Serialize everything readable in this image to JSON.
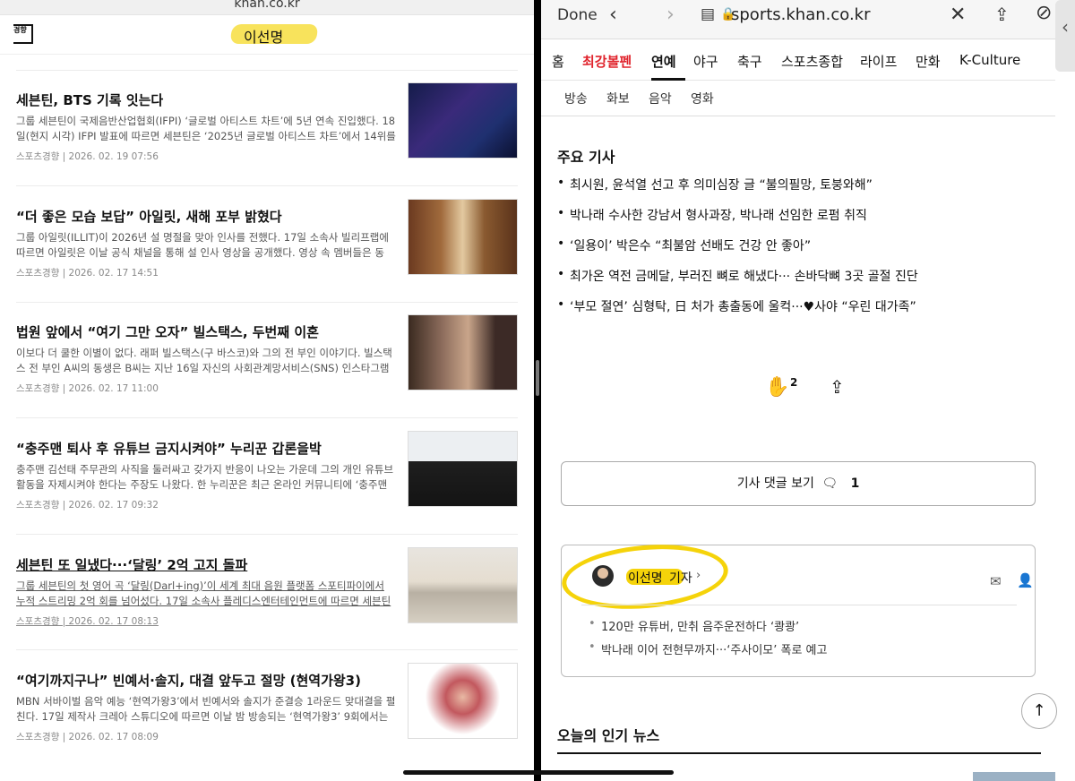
{
  "left": {
    "url": "khan.co.kr",
    "logo": "경향",
    "title": "이선명",
    "articles": [
      {
        "title": "세븐틴, BTS 기록 잇는다",
        "summary": "그룹 세븐틴이 국제음반산업협회(IFPI) ‘글로벌 아티스트 차트’에 5년 연속 진입했다. 18일(현지 시각) IFPI 발표에 따르면 세븐틴은 ‘2025년 글로벌 아티스트 차트’에서 14위를 기록…",
        "meta": "스포츠경향 | 2026. 02. 19 07:56"
      },
      {
        "title": "“더 좋은 모습 보답” 아일릿, 새해 포부 밝혔다",
        "summary": "그룹 아일릿(ILLIT)이 2026년 설 명절을 맞아 인사를 전했다. 17일 소속사 빌리프랩에 따르면 아일릿은 이날 공식 채널을 통해 설 인사 영상을 공개했다. 영상 속 멤버들은 동양…",
        "meta": "스포츠경향 | 2026. 02. 17 14:51"
      },
      {
        "title": "법원 앞에서 “여기 그만 오자” 빌스택스, 두번째 이혼",
        "summary": "이보다 더 쿨한 이별이 없다. 래퍼 빌스택스(구 바스코)와 그의 전 부인 이야기다. 빌스택스 전 부인 A씨의 동생은 B씨는 지난 16일 자신의 사회관계망서비스(SNS) 인스타그램에 “이혼…",
        "meta": "스포츠경향 | 2026. 02. 17 11:00"
      },
      {
        "title": "“충주맨 퇴사 후 유튜브 금지시켜야” 누리꾼 갑론을박",
        "summary": "충주맨 김선태 주무관의 사직을 둘러싸고 갖가지 반응이 나오는 가운데 그의 개인 유튜브 활동을 자제시켜야 한다는 주장도 나왔다. 한 누리꾼은 최근 온라인 커뮤니티에 ‘충주맨 퇴…",
        "meta": "스포츠경향 | 2026. 02. 17 09:32"
      },
      {
        "title": "세븐틴 또 일냈다···‘달링’ 2억 고지 돌파",
        "summary": "그룹 세븐틴의 첫 영어 곡 ‘달링(Darl+ing)’이 세계 최대 음원 플랫폼 스포티파이에서 누적 스트리밍 2억 회를 넘어섰다. 17일 소속사 플레디스엔터테인먼트에 따르면 세븐틴 정규 4집…",
        "meta": "스포츠경향 | 2026. 02. 17 08:13"
      },
      {
        "title": "“여기까지구나” 빈예서·솔지, 대결 앞두고 절망 (현역가왕3)",
        "summary": "MBN 서바이벌 음악 예능 ‘현역가왕3’에서 빈예서와 솔지가 준결승 1라운드 맞대결을 펼친다. 17일 제작사 크레아 스튜디오에 따르면 이날 밤 방송되는 ‘현역가왕3’ 9회에서는 준결…",
        "meta": "스포츠경향 | 2026. 02. 17 08:09"
      }
    ]
  },
  "right": {
    "done": "Done",
    "host": "sports.khan.co.kr",
    "nav": [
      "홈",
      "최강볼펜",
      "연예",
      "야구",
      "축구",
      "스포츠종합",
      "라이프",
      "만화",
      "K-Culture"
    ],
    "subnav": [
      "방송",
      "화보",
      "음악",
      "영화"
    ],
    "key_title": "주요 기사",
    "key_articles": [
      "최시원, 윤석열 선고 후 의미심장 글 “불의필망, 토붕와해”",
      "박나래 수사한 강남서 형사과장, 박나래 선임한 로펌 취직",
      "‘일용이’ 박은수 “최불암 선배도 건강 안 좋아”",
      "최가온 역전 금메달, 부러진 뼈로 해냈다··· 손바닥뼈 3곳 골절 진단",
      "‘부모 절연’ 심형탁, 日 처가 총출동에 울컥···♥사야 “우린 대가족”"
    ],
    "clap_count": "2",
    "comments_label": "기사 댓글 보기",
    "comments_count": "1",
    "reporter_name": "이선명",
    "reporter_role": "기자",
    "reporter_articles": [
      "120만 유튜버, 만취 음주운전하다 ‘쾅쾅’",
      "박나래 이어 전현무까지···‘주사이모’ 폭로 예고"
    ],
    "popular_title": "오늘의 인기 뉴스"
  }
}
